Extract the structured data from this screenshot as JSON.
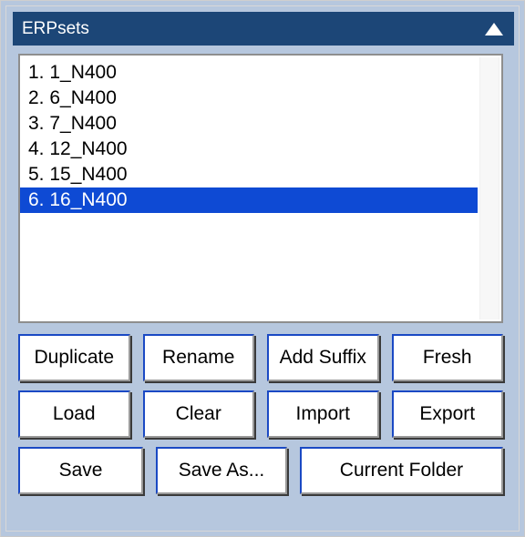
{
  "panel": {
    "title": "ERPsets",
    "collapse_icon": "triangle-up-icon",
    "accent_color": "#1c4677",
    "background_color": "#b6c7de",
    "selection_color": "#0e4ad4",
    "button_border_color": "#1a49c4"
  },
  "erpset_list": {
    "selected_index": 5,
    "items": [
      {
        "label": "1. 1_N400",
        "selected": false
      },
      {
        "label": "2. 6_N400",
        "selected": false
      },
      {
        "label": "3. 7_N400",
        "selected": false
      },
      {
        "label": "4. 12_N400",
        "selected": false
      },
      {
        "label": "5. 15_N400",
        "selected": false
      },
      {
        "label": "6. 16_N400",
        "selected": true
      }
    ]
  },
  "buttons": {
    "row1": [
      {
        "label": "Duplicate",
        "name": "duplicate-button"
      },
      {
        "label": "Rename",
        "name": "rename-button"
      },
      {
        "label": "Add Suffix",
        "name": "add-suffix-button"
      },
      {
        "label": "Fresh",
        "name": "fresh-button"
      }
    ],
    "row2": [
      {
        "label": "Load",
        "name": "load-button"
      },
      {
        "label": "Clear",
        "name": "clear-button"
      },
      {
        "label": "Import",
        "name": "import-button"
      },
      {
        "label": "Export",
        "name": "export-button"
      }
    ],
    "row3": [
      {
        "label": "Save",
        "name": "save-button"
      },
      {
        "label": "Save As...",
        "name": "save-as-button"
      },
      {
        "label": "Current Folder",
        "name": "current-folder-button"
      }
    ]
  }
}
